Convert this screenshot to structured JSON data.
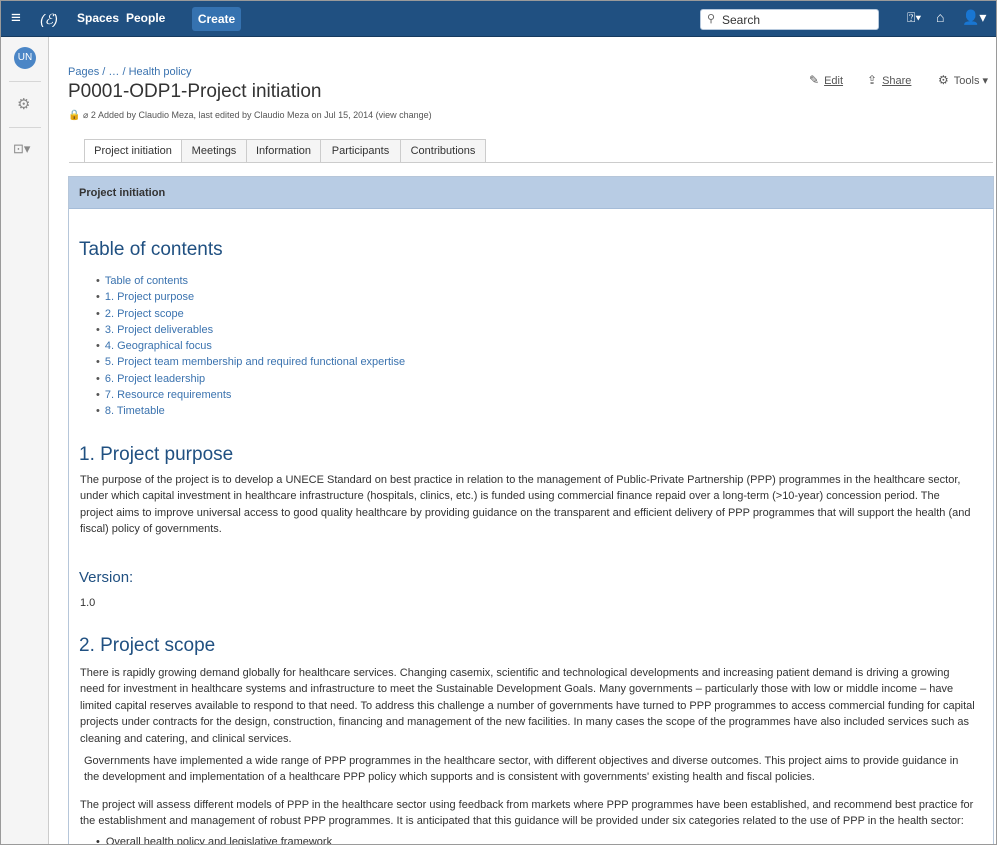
{
  "topbar": {
    "spaces": "Spaces",
    "people": "People",
    "create": "Create",
    "search_placeholder": "Search",
    "help_icon": "?",
    "bell_icon": "bell-icon",
    "user_icon": "user-icon"
  },
  "breadcrumb": {
    "pages": "Pages",
    "sep1": "/",
    "ellipsis": "…",
    "sep2": "/",
    "parent": "Health policy"
  },
  "page": {
    "title": "P0001-ODP1-Project initiation",
    "meta_count": "2",
    "meta_text": "Added by Claudio Meza, last edited by Claudio Meza on Jul 15, 2014",
    "view_change": "(view change)"
  },
  "actions": {
    "edit": "Edit",
    "share": "Share",
    "tools": "Tools"
  },
  "tabs": [
    "Project initiation",
    "Meetings",
    "Information",
    "Participants",
    "Contributions"
  ],
  "panel": {
    "header": "Project initiation"
  },
  "toc": {
    "heading": "Table of contents",
    "items": [
      "Table of contents",
      "1. Project purpose",
      "2. Project scope",
      "3. Project deliverables",
      "4. Geographical focus",
      "5. Project team membership and required functional expertise",
      "6. Project leadership",
      "7. Resource requirements",
      "8. Timetable"
    ]
  },
  "section1": {
    "heading": "1. Project purpose",
    "text": "The purpose of the project is to develop a UNECE Standard on best practice in relation to the management of Public-Private Partnership (PPP) programmes in the healthcare sector, under which capital investment in healthcare infrastructure (hospitals, clinics, etc.) is funded using commercial finance repaid over a long-term (>10-year) concession period. The project aims to improve universal access to good quality healthcare by providing guidance on the transparent and efficient delivery of PPP programmes that will support the health (and fiscal) policy of governments.",
    "version_label": "Version:",
    "version_value": "1.0"
  },
  "section2": {
    "heading": "2. Project scope",
    "p1": "There is rapidly growing demand globally for healthcare services. Changing casemix, scientific and technological developments and increasing patient demand is driving a growing need for investment in healthcare systems and infrastructure to meet the Sustainable Development Goals. Many governments – particularly those with low or middle income – have limited capital reserves available to respond to that need. To address this challenge a number of governments have turned to PPP programmes to access commercial funding for capital projects under contracts for the design, construction, financing and management of the new facilities. In many cases the scope of the programmes have also included services such as cleaning and catering, and clinical services.",
    "p2": "Governments have implemented a wide range of PPP programmes in the healthcare sector, with different objectives and diverse outcomes. This project aims to provide guidance in the development and implementation of a healthcare PPP policy which supports and is consistent with governments' existing health and fiscal policies.",
    "p3": "The project will assess different models of PPP in the healthcare sector using feedback from markets where PPP programmes have been established, and recommend best practice for the establishment and management of robust PPP programmes. It is anticipated that this guidance will be provided under six categories related to the use of PPP in the health sector:",
    "bullet1": "Overall health policy and legislative framework"
  }
}
